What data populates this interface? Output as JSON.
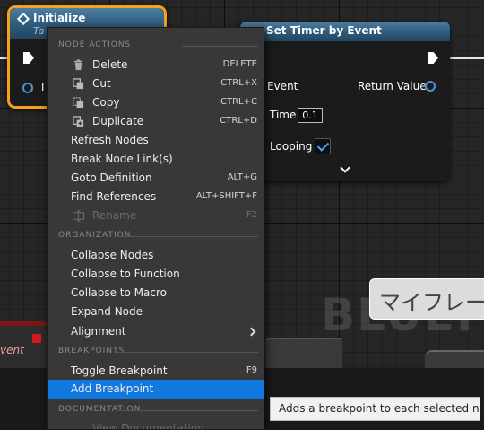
{
  "graph": {
    "watermark": "BLUEPRINT",
    "japanese_node_label": "マイフレー",
    "event_fragment": "vent"
  },
  "initialize_node": {
    "title": "Initialize",
    "subtitle": "Ta",
    "pin_label_fragment": "T",
    "accent_color": "#f4a21c"
  },
  "timer_node": {
    "title": "Set Timer by Event",
    "event_label": "Event",
    "return_label": "Return Value",
    "time_label": "Time",
    "time_value": "0.1",
    "looping_label": "Looping",
    "looping_checked": true
  },
  "context_menu": {
    "sections": {
      "node_actions": "NODE ACTIONS",
      "organization": "ORGANIZATION",
      "breakpoints": "BREAKPOINTS",
      "documentation": "DOCUMENTATION"
    },
    "node_actions": [
      {
        "label": "Delete",
        "shortcut": "DELETE",
        "icon": "trash-icon"
      },
      {
        "label": "Cut",
        "shortcut": "CTRL+X",
        "icon": "cut-icon"
      },
      {
        "label": "Copy",
        "shortcut": "CTRL+C",
        "icon": "copy-icon"
      },
      {
        "label": "Duplicate",
        "shortcut": "CTRL+D",
        "icon": "duplicate-icon"
      },
      {
        "label": "Refresh Nodes",
        "shortcut": ""
      },
      {
        "label": "Break Node Link(s)",
        "shortcut": ""
      },
      {
        "label": "Goto Definition",
        "shortcut": "ALT+G"
      },
      {
        "label": "Find References",
        "shortcut": "ALT+SHIFT+F"
      },
      {
        "label": "Rename",
        "shortcut": "F2",
        "icon": "rename-icon",
        "disabled": true
      }
    ],
    "organization": [
      {
        "label": "Collapse Nodes"
      },
      {
        "label": "Collapse to Function"
      },
      {
        "label": "Collapse to Macro"
      },
      {
        "label": "Expand Node"
      },
      {
        "label": "Alignment",
        "submenu": true
      }
    ],
    "breakpoints": [
      {
        "label": "Toggle Breakpoint",
        "shortcut": "F9"
      },
      {
        "label": "Add Breakpoint",
        "shortcut": "",
        "highlighted": true
      }
    ],
    "documentation": [
      {
        "label": "View Documentation",
        "disabled": true
      }
    ],
    "highlight_color": "#1178e0"
  },
  "tooltip": {
    "text": "Adds a breakpoint to each selected node"
  }
}
